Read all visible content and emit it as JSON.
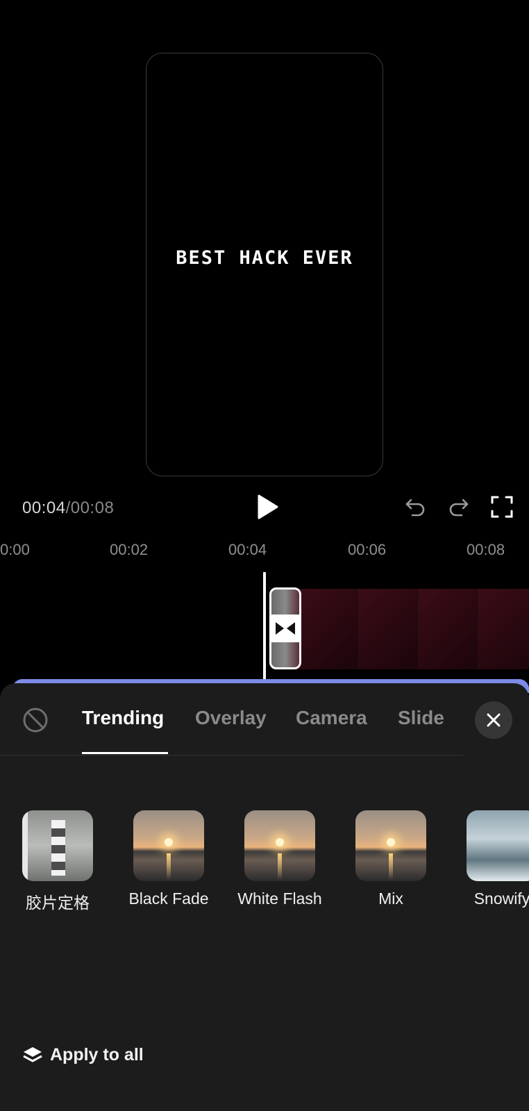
{
  "preview": {
    "overlay_text": "BEST HACK EVER"
  },
  "playback": {
    "current_time": "00:04",
    "separator": "/",
    "total_time": "00:08"
  },
  "ruler": {
    "ticks": [
      "0:00",
      "00:02",
      "00:04",
      "00:06",
      "00:08"
    ]
  },
  "transition_panel": {
    "tabs": [
      {
        "label": "Trending",
        "active": true
      },
      {
        "label": "Overlay",
        "active": false
      },
      {
        "label": "Camera",
        "active": false
      },
      {
        "label": "Slide",
        "active": false
      }
    ],
    "effects": [
      {
        "label": "胶片定格",
        "thumbnail": "lighthouse-film"
      },
      {
        "label": "Black Fade",
        "thumbnail": "sunset"
      },
      {
        "label": "White Flash",
        "thumbnail": "sunset"
      },
      {
        "label": "Mix",
        "thumbnail": "sunset"
      },
      {
        "label": "Snowify",
        "thumbnail": "snowy-landscape"
      }
    ],
    "apply_all_label": "Apply to all"
  },
  "colors": {
    "sheet_bg": "#1c1c1c",
    "sheet_accent": "#7d8be6",
    "clip_color": "#3b0d17"
  },
  "icons": [
    "play-icon",
    "undo-icon",
    "redo-icon",
    "fullscreen-icon",
    "transition-bowtie-icon",
    "none-icon",
    "close-icon",
    "layers-icon"
  ]
}
